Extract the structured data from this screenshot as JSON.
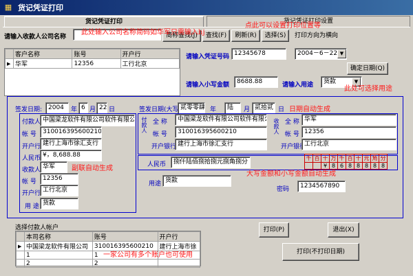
{
  "window": {
    "title": "货记凭证打印"
  },
  "tabs": [
    "货记凭证打印",
    "货记凭证打印设置"
  ],
  "top": {
    "payee_prompt": "请输入收款人公司名称",
    "payee_value": "",
    "btn_simple": "简称查找(J)",
    "btn_find": "查找(F)",
    "btn_refresh": "刷新(R)",
    "btn_select": "选择(S)",
    "print_dir": "打印方向为横向",
    "voucher_prompt": "请输入凭证号码",
    "voucher_value": "12345678",
    "date_value": "2004－6－22",
    "btn_confirm_date": "确定日期(Q)",
    "amount_prompt": "请输入小写金额",
    "amount_value": "8688.88",
    "purpose_prompt": "请输入用途",
    "purpose_value": "货款"
  },
  "annotations": {
    "a1": "此处输入公司名称简码如华军只需输入hj",
    "a2": "点此可以设置打印位置等",
    "a3": "此处可选择用途",
    "a4": "日期自动生成",
    "a5": "副联自动生成",
    "a6": "大写金额和小写金额自动生成",
    "a7": "一家公司有多个账户也可使用"
  },
  "payee_grid": {
    "headers": [
      "客户名称",
      "账号",
      "开户行"
    ],
    "rows": [
      [
        "华军",
        "12356",
        "工行北京"
      ]
    ]
  },
  "form": {
    "sign_date_label": "签发日期:",
    "year": "2004",
    "month": "6",
    "day": "22",
    "y": "年",
    "m": "月",
    "d": "日",
    "big_date_label": "签发日期(大写)",
    "big_year": "贰零零肆",
    "big_month": "陆",
    "big_day": "贰拾贰",
    "stub": {
      "payer_label": "付款人",
      "payer": "中国梁龙软件有限公司软件有限公司",
      "acct_label": "帐  号",
      "acct": "310016395600210",
      "bank_label": "开户行",
      "bank": "建行上海市徐汇支行",
      "rmb_label": "人民币",
      "rmb": "¥，8,688.88",
      "payee_label": "收款人",
      "payee": "华军",
      "payee_acct_label": "帐  号",
      "payee_acct": "12356",
      "payee_bank_label": "开户行",
      "payee_bank": "工行北京",
      "purpose_label": "用  途",
      "purpose": "货款"
    },
    "main": {
      "payer_side": "付款人",
      "full_label": "全  称",
      "full": "中国梁龙软件有限公司软件有限公司",
      "acct_label": "帐  号",
      "acct": "310016395600210",
      "bank_label": "开户银行",
      "bank": "建行上海市徐汇支行",
      "payee_side": "收款人",
      "p_full_label": "全  称",
      "p_full": "华军",
      "p_acct_label": "帐  号",
      "p_acct": "12356",
      "p_bank_label": "开户银行",
      "p_bank": "工行北京",
      "rmb_label": "人民币",
      "rmb_big": "捌仟陆佰捌拾捌元捌角捌分",
      "digit_heads": [
        "千",
        "百",
        "十",
        "万",
        "千",
        "百",
        "十",
        "元",
        "角",
        "分"
      ],
      "digits": [
        "",
        "",
        "¥",
        "8",
        "6",
        "8",
        "8",
        "8",
        "8",
        "8"
      ],
      "purpose_label": "用途",
      "purpose": "货款",
      "pwd_label": "密码",
      "pwd": "1234567890"
    }
  },
  "account_grid": {
    "caption": "选择付款人帐户",
    "headers": [
      "本司名称",
      "账号",
      "开户行"
    ],
    "rows": [
      [
        "中国梁龙软件有限公司",
        "310016395600210",
        "建行上海市徐"
      ],
      [
        "1",
        "1",
        ""
      ],
      [
        "2",
        "2",
        ""
      ]
    ]
  },
  "buttons": {
    "print": "打印(P)",
    "exit": "退出(X)",
    "print_nodate": "打印(不打印日期)"
  }
}
